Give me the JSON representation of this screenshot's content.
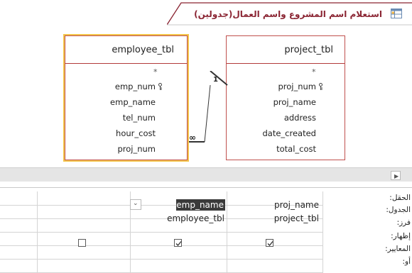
{
  "tab": {
    "title": "استعلام اسم المشروع واسم العمال(جدولين)"
  },
  "tables": {
    "employee": {
      "name": "employee_tbl",
      "star": "*",
      "fields": [
        "emp_num",
        "emp_name",
        "tel_num",
        "hour_cost",
        "proj_num"
      ]
    },
    "project": {
      "name": "project_tbl",
      "star": "*",
      "fields": [
        "proj_num",
        "proj_name",
        "address",
        "date_created",
        "total_cost"
      ]
    }
  },
  "relationship": {
    "one_label": "1",
    "many_label": "∞"
  },
  "grid": {
    "row_labels": [
      "الحقل:",
      "الجدول:",
      "فرز:",
      "إظهار:",
      "المعايير:",
      "أو:"
    ],
    "columns": [
      {
        "field": "proj_name",
        "table": "project_tbl",
        "show": true
      },
      {
        "field": "emp_name",
        "table": "employee_tbl",
        "show": true
      },
      {
        "field": "",
        "table": "",
        "show": false
      }
    ]
  },
  "colors": {
    "table_border": "#c0504d",
    "selected_outline": "#f3c44a",
    "tab_title": "#8a2432"
  }
}
